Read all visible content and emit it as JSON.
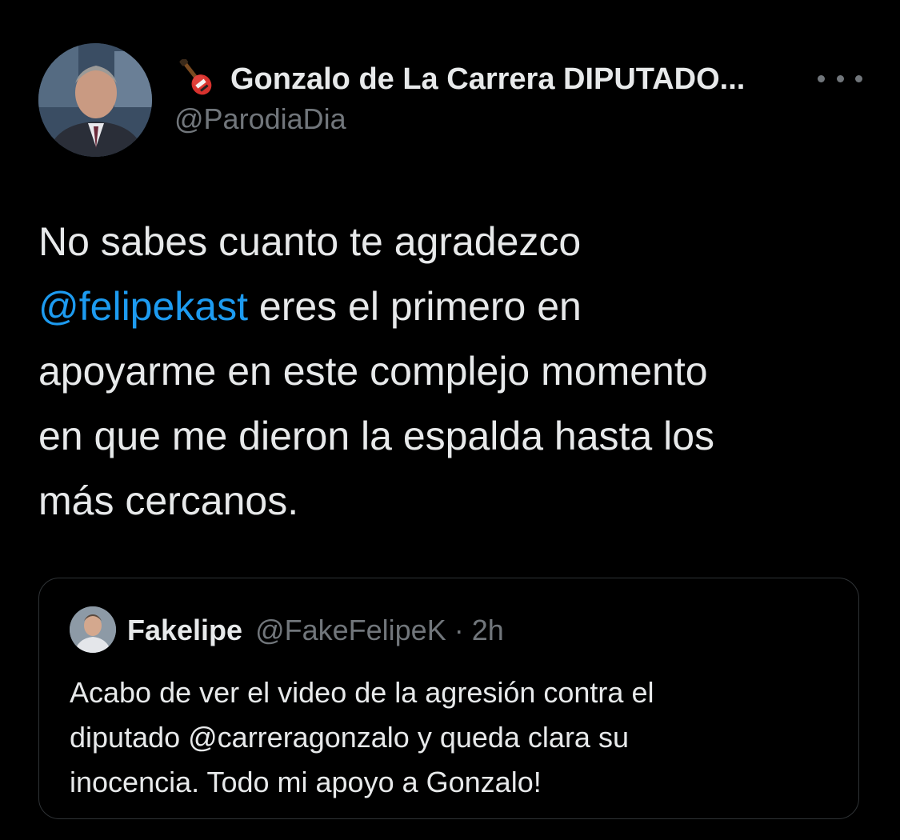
{
  "tweet": {
    "author": {
      "display_name": "Gonzalo de La Carrera DIPUTADO...",
      "emoji_icon": "guitar-icon",
      "handle": "@ParodiaDia"
    },
    "more_icon": "more-options-icon",
    "text": {
      "line1": "No sabes cuanto te agradezco",
      "mention": "@felipekast",
      "line2_rest": " eres el primero en",
      "line3": "apoyarme en este complejo momento",
      "line4": "en que me dieron la espalda hasta los",
      "line5": "más cercanos."
    }
  },
  "quoted_tweet": {
    "display_name": "Fakelipe",
    "handle_time": "@FakeFelipeK · 2h",
    "text": {
      "line1": "Acabo de ver el video de la agresión contra el",
      "line2": "diputado @carreragonzalo y queda clara su",
      "line3": "inocencia. Todo mi apoyo a Gonzalo!"
    }
  },
  "colors": {
    "background": "#000000",
    "text": "#e7e9ea",
    "secondary": "#71767b",
    "link": "#1d9bf0",
    "border": "#2f3336"
  }
}
